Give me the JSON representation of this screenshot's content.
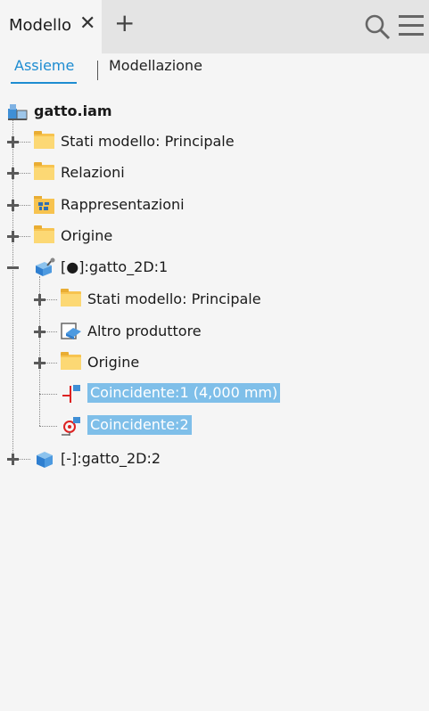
{
  "header": {
    "tab_label": "Modello"
  },
  "subtabs": {
    "active": "Assieme",
    "inactive": "Modellazione"
  },
  "tree": {
    "root": "gatto.iam",
    "items": [
      "Stati modello: Principale",
      "Relazioni",
      "Rappresentazioni",
      "Origine",
      "[●]:gatto_2D:1",
      "Stati modello: Principale",
      "Altro produttore",
      "Origine",
      "Coincidente:1 (4,000 mm)",
      "Coincidente:2",
      "[-]:gatto_2D:2"
    ]
  },
  "colors": {
    "accent": "#1d8cd1",
    "selection": "#7fbfe9",
    "folder": "#f7c34f"
  }
}
